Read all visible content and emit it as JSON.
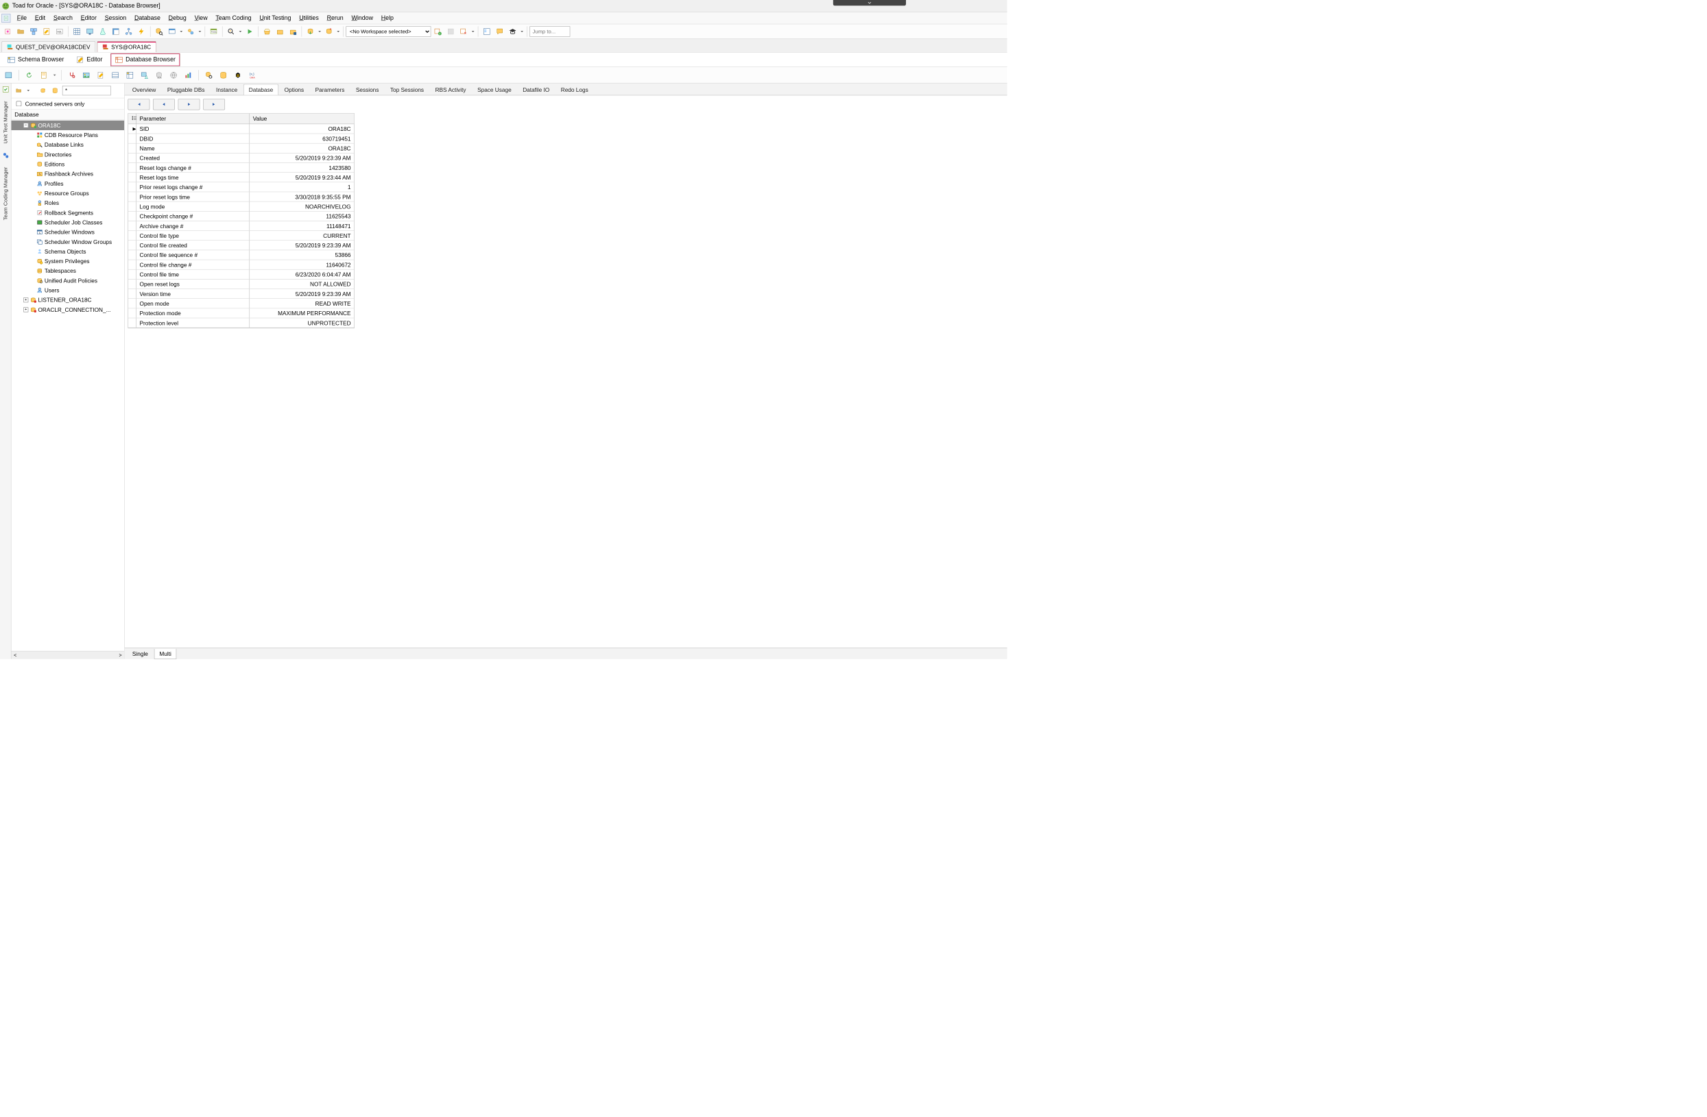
{
  "window": {
    "title": "Toad for Oracle - [SYS@ORA18C - Database Browser]"
  },
  "menu": {
    "items": [
      "File",
      "Edit",
      "Search",
      "Editor",
      "Session",
      "Database",
      "Debug",
      "View",
      "Team Coding",
      "Unit Testing",
      "Utilities",
      "Rerun",
      "Window",
      "Help"
    ]
  },
  "toolbar": {
    "workspace_placeholder": "<No Workspace selected>",
    "jump_placeholder": "Jump to..."
  },
  "connection_tabs": {
    "items": [
      {
        "label": "QUEST_DEV@ORA18CDEV",
        "active": false
      },
      {
        "label": "SYS@ORA18C",
        "active": true
      }
    ]
  },
  "view_tabs": {
    "items": [
      {
        "label": "Schema Browser",
        "active": false
      },
      {
        "label": "Editor",
        "active": false
      },
      {
        "label": "Database Browser",
        "active": true
      }
    ]
  },
  "left_rail": {
    "tab1": "Unit Test Manager",
    "tab2": "Team Coding Manager"
  },
  "db_panel": {
    "filter_value": "*",
    "checkbox_label": "Connected servers only",
    "header_label": "Database",
    "tree": {
      "root": {
        "label": "ORA18C",
        "expanded": true,
        "selected": true
      },
      "children": [
        "CDB Resource Plans",
        "Database Links",
        "Directories",
        "Editions",
        "Flashback Archives",
        "Profiles",
        "Resource Groups",
        "Roles",
        "Rollback Segments",
        "Scheduler Job Classes",
        "Scheduler Windows",
        "Scheduler Window Groups",
        "Schema Objects",
        "System Privileges",
        "Tablespaces",
        "Unified Audit Policies",
        "Users"
      ],
      "siblings": [
        "LISTENER_ORA18C",
        "ORACLR_CONNECTION_..."
      ]
    }
  },
  "detail_tabs": {
    "items": [
      "Overview",
      "Pluggable DBs",
      "Instance",
      "Database",
      "Options",
      "Parameters",
      "Sessions",
      "Top Sessions",
      "RBS Activity",
      "Space Usage",
      "Datafile IO",
      "Redo Logs"
    ],
    "active_index": 3
  },
  "grid": {
    "col_parameter": "Parameter",
    "col_value": "Value",
    "rows": [
      {
        "param": "SID",
        "value": "ORA18C",
        "current": true
      },
      {
        "param": "DBID",
        "value": "630719451"
      },
      {
        "param": "Name",
        "value": "ORA18C"
      },
      {
        "param": "Created",
        "value": "5/20/2019 9:23:39 AM"
      },
      {
        "param": "Reset logs change #",
        "value": "1423580"
      },
      {
        "param": "Reset logs time",
        "value": "5/20/2019 9:23:44 AM"
      },
      {
        "param": "Prior reset logs change #",
        "value": "1"
      },
      {
        "param": "Prior reset logs time",
        "value": "3/30/2018 9:35:55 PM"
      },
      {
        "param": "Log mode",
        "value": "NOARCHIVELOG"
      },
      {
        "param": "Checkpoint change #",
        "value": "11625543"
      },
      {
        "param": "Archive change #",
        "value": "11148471"
      },
      {
        "param": "Control file type",
        "value": "CURRENT"
      },
      {
        "param": "Control file created",
        "value": "5/20/2019 9:23:39 AM"
      },
      {
        "param": "Control file sequence #",
        "value": "53866"
      },
      {
        "param": "Control file change #",
        "value": "11640672"
      },
      {
        "param": "Control file time",
        "value": "6/23/2020 6:04:47 AM"
      },
      {
        "param": "Open reset logs",
        "value": "NOT ALLOWED"
      },
      {
        "param": "Version time",
        "value": "5/20/2019 9:23:39 AM"
      },
      {
        "param": "Open mode",
        "value": "READ WRITE"
      },
      {
        "param": "Protection mode",
        "value": "MAXIMUM PERFORMANCE"
      },
      {
        "param": "Protection level",
        "value": "UNPROTECTED"
      }
    ]
  },
  "bottom_tabs": {
    "items": [
      "Single",
      "Multi"
    ],
    "active_index": 1
  }
}
